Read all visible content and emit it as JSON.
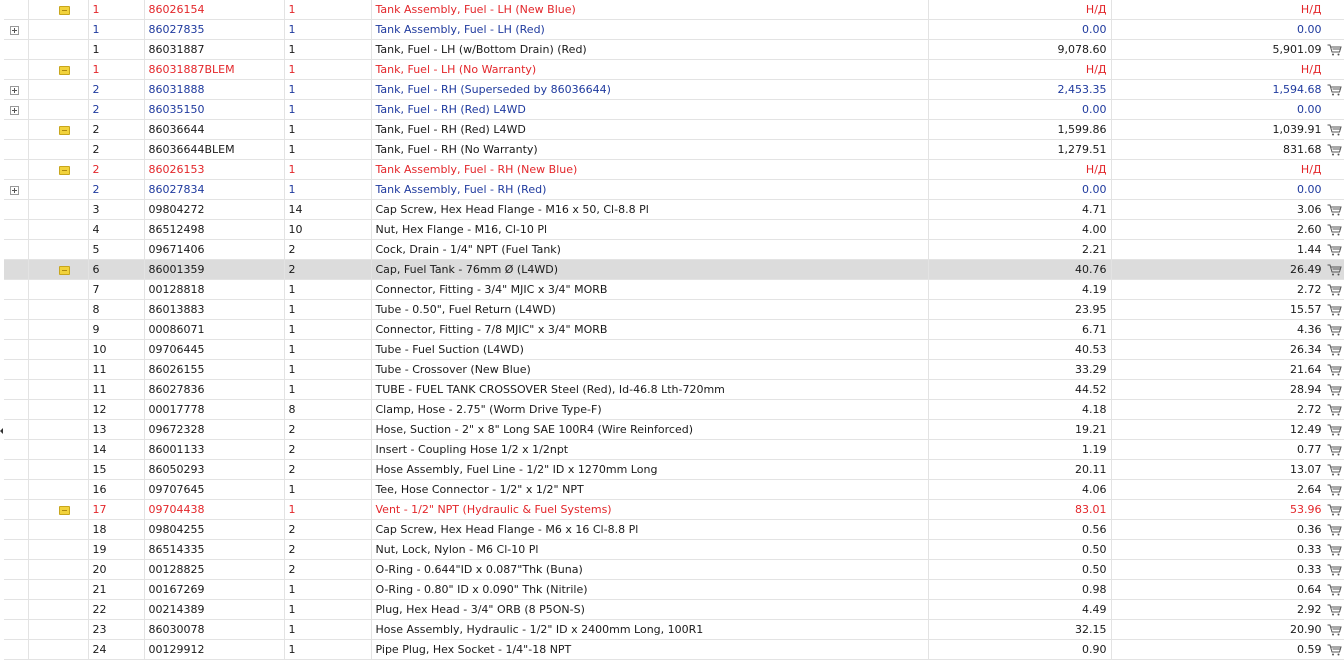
{
  "unavailable_label": "Н/Д",
  "rows": [
    {
      "icon": "note",
      "tone": "red",
      "ref": "1",
      "part": "86026154",
      "qty": "1",
      "desc": "Tank Assembly, Fuel - LH (New Blue)",
      "price1": "Н/Д",
      "price2": "Н/Д",
      "cart": false
    },
    {
      "icon": "expand",
      "tone": "blue",
      "ref": "1",
      "part": "86027835",
      "qty": "1",
      "desc": "Tank Assembly, Fuel - LH (Red)",
      "price1": "0.00",
      "price2": "0.00",
      "cart": false
    },
    {
      "icon": "",
      "tone": "",
      "ref": "1",
      "part": "86031887",
      "qty": "1",
      "desc": "Tank, Fuel - LH (w/Bottom Drain) (Red)",
      "price1": "9,078.60",
      "price2": "5,901.09",
      "cart": true
    },
    {
      "icon": "note",
      "tone": "red",
      "ref": "1",
      "part": "86031887BLEM",
      "qty": "1",
      "desc": "Tank, Fuel - LH (No Warranty)",
      "price1": "Н/Д",
      "price2": "Н/Д",
      "cart": false
    },
    {
      "icon": "expand",
      "tone": "blue",
      "ref": "2",
      "part": "86031888",
      "qty": "1",
      "desc": "Tank, Fuel - RH (Superseded by 86036644)",
      "price1": "2,453.35",
      "price2": "1,594.68",
      "cart": true
    },
    {
      "icon": "expand",
      "tone": "blue",
      "ref": "2",
      "part": "86035150",
      "qty": "1",
      "desc": "Tank, Fuel - RH (Red) L4WD",
      "price1": "0.00",
      "price2": "0.00",
      "cart": false
    },
    {
      "icon": "note",
      "tone": "",
      "ref": "2",
      "part": "86036644",
      "qty": "1",
      "desc": "Tank, Fuel - RH (Red) L4WD",
      "price1": "1,599.86",
      "price2": "1,039.91",
      "cart": true
    },
    {
      "icon": "",
      "tone": "",
      "ref": "2",
      "part": "86036644BLEM",
      "qty": "1",
      "desc": "Tank, Fuel - RH (No Warranty)",
      "price1": "1,279.51",
      "price2": "831.68",
      "cart": true
    },
    {
      "icon": "note",
      "tone": "red",
      "ref": "2",
      "part": "86026153",
      "qty": "1",
      "desc": "Tank Assembly, Fuel - RH (New Blue)",
      "price1": "Н/Д",
      "price2": "Н/Д",
      "cart": false
    },
    {
      "icon": "expand",
      "tone": "blue",
      "ref": "2",
      "part": "86027834",
      "qty": "1",
      "desc": "Tank Assembly, Fuel - RH (Red)",
      "price1": "0.00",
      "price2": "0.00",
      "cart": false
    },
    {
      "icon": "",
      "tone": "",
      "ref": "3",
      "part": "09804272",
      "qty": "14",
      "desc": "Cap Screw, Hex Head Flange - M16 x 50, Cl-8.8 Pl",
      "price1": "4.71",
      "price2": "3.06",
      "cart": true
    },
    {
      "icon": "",
      "tone": "",
      "ref": "4",
      "part": "86512498",
      "qty": "10",
      "desc": "Nut, Hex Flange - M16, Cl-10 Pl",
      "price1": "4.00",
      "price2": "2.60",
      "cart": true
    },
    {
      "icon": "",
      "tone": "",
      "ref": "5",
      "part": "09671406",
      "qty": "2",
      "desc": "Cock, Drain - 1/4\" NPT (Fuel Tank)",
      "price1": "2.21",
      "price2": "1.44",
      "cart": true
    },
    {
      "icon": "note",
      "tone": "",
      "selected": true,
      "ref": "6",
      "part": "86001359",
      "qty": "2",
      "desc": "Cap, Fuel Tank - 76mm Ø (L4WD)",
      "price1": "40.76",
      "price2": "26.49",
      "cart": true
    },
    {
      "icon": "",
      "tone": "",
      "ref": "7",
      "part": "00128818",
      "qty": "1",
      "desc": "Connector, Fitting - 3/4\" MJIC x 3/4\" MORB",
      "price1": "4.19",
      "price2": "2.72",
      "cart": true
    },
    {
      "icon": "",
      "tone": "",
      "ref": "8",
      "part": "86013883",
      "qty": "1",
      "desc": "Tube - 0.50\", Fuel Return (L4WD)",
      "price1": "23.95",
      "price2": "15.57",
      "cart": true
    },
    {
      "icon": "",
      "tone": "",
      "ref": "9",
      "part": "00086071",
      "qty": "1",
      "desc": "Connector, Fitting - 7/8 MJIC\" x 3/4\" MORB",
      "price1": "6.71",
      "price2": "4.36",
      "cart": true
    },
    {
      "icon": "",
      "tone": "",
      "ref": "10",
      "part": "09706445",
      "qty": "1",
      "desc": "Tube - Fuel Suction (L4WD)",
      "price1": "40.53",
      "price2": "26.34",
      "cart": true
    },
    {
      "icon": "",
      "tone": "",
      "ref": "11",
      "part": "86026155",
      "qty": "1",
      "desc": "Tube - Crossover (New Blue)",
      "price1": "33.29",
      "price2": "21.64",
      "cart": true
    },
    {
      "icon": "",
      "tone": "",
      "ref": "11",
      "part": "86027836",
      "qty": "1",
      "desc": "TUBE - FUEL TANK CROSSOVER Steel (Red), Id-46.8 Lth-720mm",
      "price1": "44.52",
      "price2": "28.94",
      "cart": true
    },
    {
      "icon": "",
      "tone": "",
      "ref": "12",
      "part": "00017778",
      "qty": "8",
      "desc": "Clamp, Hose - 2.75\" (Worm Drive Type-F)",
      "price1": "4.18",
      "price2": "2.72",
      "cart": true
    },
    {
      "icon": "",
      "tone": "",
      "ref": "13",
      "part": "09672328",
      "qty": "2",
      "desc": "Hose, Suction - 2\" x 8\" Long SAE 100R4 (Wire Reinforced)",
      "price1": "19.21",
      "price2": "12.49",
      "cart": true
    },
    {
      "icon": "",
      "tone": "",
      "ref": "14",
      "part": "86001133",
      "qty": "2",
      "desc": "Insert - Coupling Hose 1/2 x 1/2npt",
      "price1": "1.19",
      "price2": "0.77",
      "cart": true
    },
    {
      "icon": "",
      "tone": "",
      "ref": "15",
      "part": "86050293",
      "qty": "2",
      "desc": "Hose Assembly, Fuel Line - 1/2\" ID x 1270mm Long",
      "price1": "20.11",
      "price2": "13.07",
      "cart": true
    },
    {
      "icon": "",
      "tone": "",
      "ref": "16",
      "part": "09707645",
      "qty": "1",
      "desc": "Tee, Hose Connector - 1/2\" x 1/2\" NPT",
      "price1": "4.06",
      "price2": "2.64",
      "cart": true
    },
    {
      "icon": "note",
      "tone": "red",
      "ref": "17",
      "part": "09704438",
      "qty": "1",
      "desc": "Vent - 1/2\" NPT (Hydraulic & Fuel Systems)",
      "price1": "83.01",
      "price2": "53.96",
      "cart": true
    },
    {
      "icon": "",
      "tone": "",
      "ref": "18",
      "part": "09804255",
      "qty": "2",
      "desc": "Cap Screw, Hex Head Flange - M6 x 16 Cl-8.8 Pl",
      "price1": "0.56",
      "price2": "0.36",
      "cart": true
    },
    {
      "icon": "",
      "tone": "",
      "ref": "19",
      "part": "86514335",
      "qty": "2",
      "desc": "Nut, Lock, Nylon - M6 Cl-10 Pl",
      "price1": "0.50",
      "price2": "0.33",
      "cart": true
    },
    {
      "icon": "",
      "tone": "",
      "ref": "20",
      "part": "00128825",
      "qty": "2",
      "desc": "O-Ring - 0.644\"ID x 0.087\"Thk (Buna)",
      "price1": "0.50",
      "price2": "0.33",
      "cart": true
    },
    {
      "icon": "",
      "tone": "",
      "ref": "21",
      "part": "00167269",
      "qty": "1",
      "desc": "O-Ring - 0.80\" ID x 0.090\" Thk (Nitrile)",
      "price1": "0.98",
      "price2": "0.64",
      "cart": true
    },
    {
      "icon": "",
      "tone": "",
      "ref": "22",
      "part": "00214389",
      "qty": "1",
      "desc": "Plug, Hex Head - 3/4\" ORB (8 P5ON-S)",
      "price1": "4.49",
      "price2": "2.92",
      "cart": true
    },
    {
      "icon": "",
      "tone": "",
      "ref": "23",
      "part": "86030078",
      "qty": "1",
      "desc": "Hose Assembly, Hydraulic - 1/2\" ID x 2400mm Long, 100R1",
      "price1": "32.15",
      "price2": "20.90",
      "cart": true
    },
    {
      "icon": "",
      "tone": "",
      "ref": "24",
      "part": "00129912",
      "qty": "1",
      "desc": "Pipe Plug, Hex Socket - 1/4\"-18 NPT",
      "price1": "0.90",
      "price2": "0.59",
      "cart": true
    }
  ]
}
